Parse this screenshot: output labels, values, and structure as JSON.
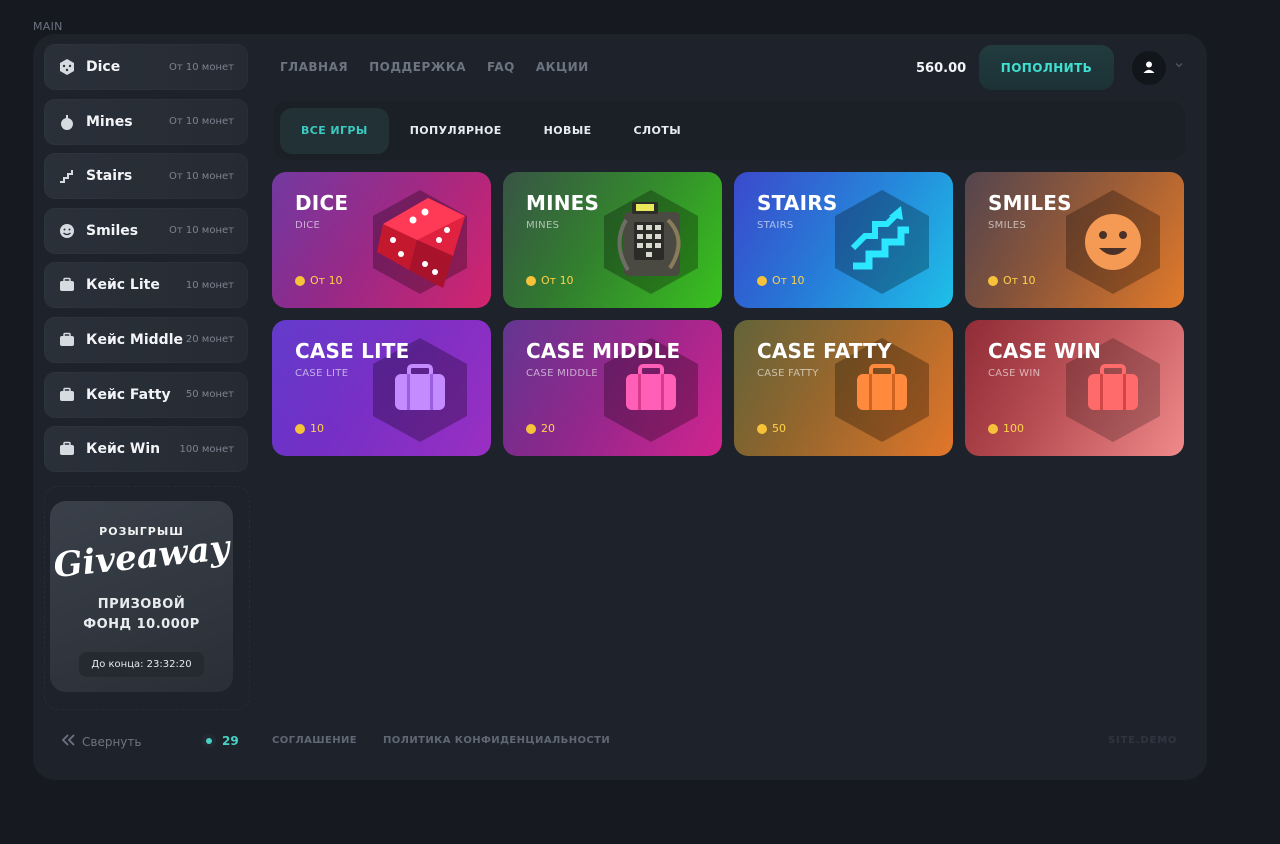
{
  "page_label": "MAIN",
  "sidebar": {
    "items": [
      {
        "name": "Dice",
        "price": "От 10 монет",
        "icon": "dice-icon"
      },
      {
        "name": "Mines",
        "price": "От 10 монет",
        "icon": "bomb-icon"
      },
      {
        "name": "Stairs",
        "price": "От 10 монет",
        "icon": "stairs-icon"
      },
      {
        "name": "Smiles",
        "price": "От 10 монет",
        "icon": "smile-icon"
      },
      {
        "name": "Кейс Lite",
        "price": "10 монет",
        "icon": "briefcase-icon"
      },
      {
        "name": "Кейс Middle",
        "price": "20 монет",
        "icon": "briefcase-icon"
      },
      {
        "name": "Кейс Fatty",
        "price": "50 монет",
        "icon": "briefcase-icon"
      },
      {
        "name": "Кейс Win",
        "price": "100 монет",
        "icon": "briefcase-icon"
      }
    ],
    "promo": {
      "small_title": "РОЗЫГРЫШ",
      "script_title": "Giveaway",
      "title_line1": "ПРИЗОВОЙ",
      "title_line2": "ФОНД 10.000Р",
      "timer": "До конца: 23:32:20"
    },
    "collapse_label": "Свернуть",
    "online_count": "29"
  },
  "header": {
    "nav": [
      "ГЛАВНАЯ",
      "ПОДДЕРЖКА",
      "FAQ",
      "АКЦИИ"
    ],
    "balance": "560.00",
    "topup_label": "ПОПОЛНИТЬ",
    "avatar_icon": "user-icon"
  },
  "tabs": [
    "ВСЕ ИГРЫ",
    "ПОПУЛЯРНОЕ",
    "НОВЫЕ",
    "СЛОТЫ"
  ],
  "active_tab": "ВСЕ ИГРЫ",
  "cards": [
    {
      "title": "DICE",
      "sub": "DICE",
      "price": "От 10",
      "icon": "red-dice-icon",
      "colors": [
        "#6a2d9b",
        "#d2246e"
      ]
    },
    {
      "title": "MINES",
      "sub": "MINES",
      "price": "От 10",
      "icon": "bomb-device-icon",
      "colors": [
        "#2c4a3a",
        "#39c21f"
      ]
    },
    {
      "title": "STAIRS",
      "sub": "STAIRS",
      "price": "От 10",
      "icon": "stairs-arrow-icon",
      "colors": [
        "#2f3fc9",
        "#1ec0e8"
      ]
    },
    {
      "title": "SMILES",
      "sub": "SMILES",
      "price": "От 10",
      "icon": "smiley-face-icon",
      "colors": [
        "#4a3a44",
        "#e27a2a"
      ]
    },
    {
      "title": "CASE LITE",
      "sub": "CASE LITE",
      "price": "10",
      "icon": "briefcase-purple-icon",
      "colors": [
        "#5a2fc8",
        "#9b2fc2"
      ]
    },
    {
      "title": "CASE MIDDLE",
      "sub": "CASE MIDDLE",
      "price": "20",
      "icon": "briefcase-pink-icon",
      "colors": [
        "#5a2a8a",
        "#d2248e"
      ]
    },
    {
      "title": "CASE FATTY",
      "sub": "CASE FATTY",
      "price": "50",
      "icon": "briefcase-orange-icon",
      "colors": [
        "#5a5a2e",
        "#e2762a"
      ]
    },
    {
      "title": "CASE WIN",
      "sub": "CASE WIN",
      "price": "100",
      "icon": "briefcase-red-icon",
      "colors": [
        "#8a1f2a",
        "#f08a8a"
      ]
    }
  ],
  "footer": {
    "links": [
      "СОГЛАШЕНИЕ",
      "ПОЛИТИКА КОНФИДЕНЦИАЛЬНОСТИ"
    ],
    "site": "SITE.DEMO"
  }
}
